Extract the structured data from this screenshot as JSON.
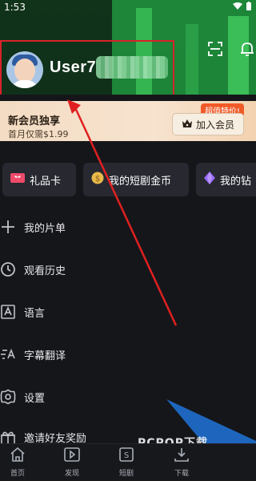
{
  "status_bar": {
    "time": "1:53",
    "icons": [
      "wifi-icon",
      "battery-icon"
    ]
  },
  "profile": {
    "username": "User7",
    "avatar_icon": "avatar-icon"
  },
  "header_actions": {
    "scan_icon": "scan-icon",
    "notification_icon": "bell-icon"
  },
  "vip_banner": {
    "title": "新会员独享",
    "subtitle": "首月仅需$1.99",
    "badge": "超值特价!",
    "button_label": "加入会员",
    "accent": "#f05a28"
  },
  "quick_links": [
    {
      "label": "礼品卡",
      "icon": "gift-card-icon"
    },
    {
      "label": "我的短剧金币",
      "icon": "coin-icon"
    },
    {
      "label": "我的钻",
      "icon": "diamond-icon"
    }
  ],
  "menu": [
    {
      "label": "我的片单",
      "icon": "plus-icon"
    },
    {
      "label": "观看历史",
      "icon": "clock-icon"
    },
    {
      "label": "语言",
      "icon": "language-icon"
    },
    {
      "label": "字幕翻译",
      "icon": "subtitle-icon"
    },
    {
      "label": "设置",
      "icon": "gear-icon"
    },
    {
      "label": "邀请好友奖励",
      "icon": "gift-icon"
    }
  ],
  "tab_bar": [
    {
      "label": "首页",
      "icon": "home-icon"
    },
    {
      "label": "发现",
      "icon": "discover-icon"
    },
    {
      "label": "短剧",
      "icon": "short-drama-icon"
    },
    {
      "label": "下载",
      "icon": "download-icon"
    }
  ],
  "watermark": {
    "text": "PCPOP下载"
  },
  "colors": {
    "header_green": "#2ea84a",
    "background": "#15161a",
    "highlight_red": "#d8222a"
  }
}
